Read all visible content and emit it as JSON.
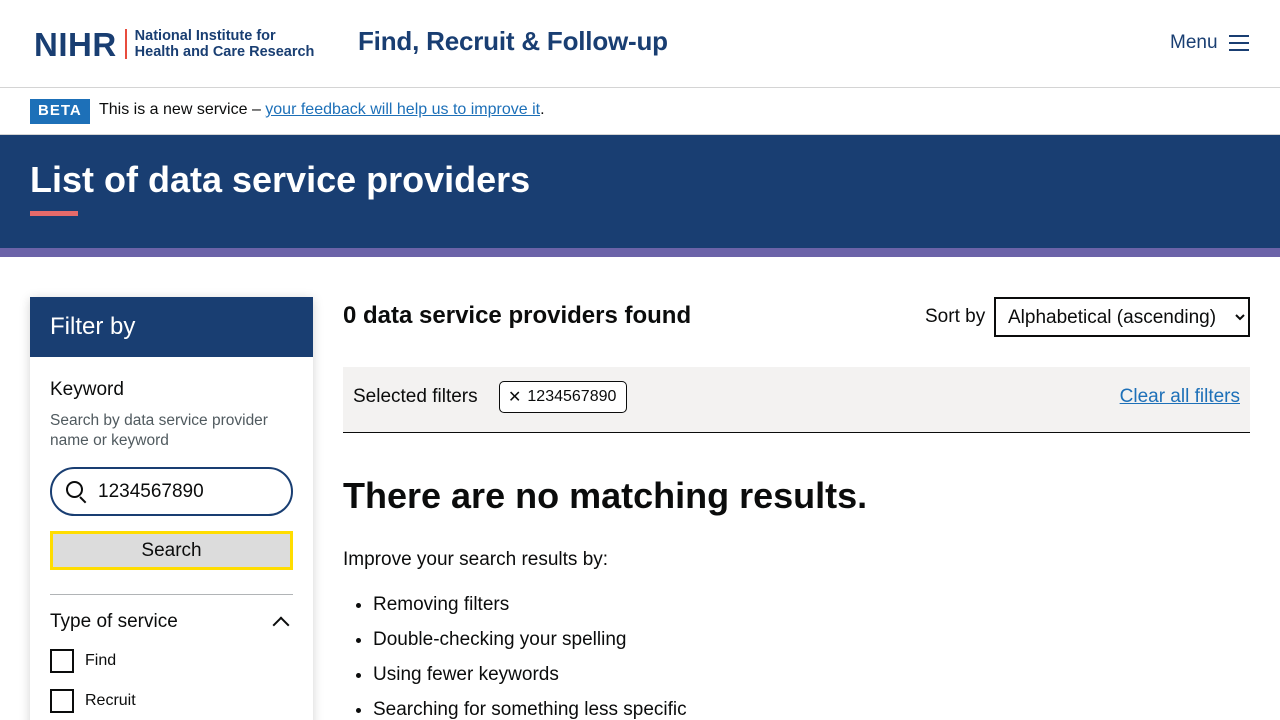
{
  "header": {
    "logo_mark": "NIHR",
    "logo_line1": "National Institute for",
    "logo_line2": "Health and Care Research",
    "service_name": "Find, Recruit & Follow-up",
    "menu_label": "Menu"
  },
  "beta_banner": {
    "tag": "BETA",
    "text_before": "This is a new service – ",
    "link_text": "your feedback will help us to improve it",
    "text_after": "."
  },
  "page": {
    "title": "List of data service providers"
  },
  "filter": {
    "heading": "Filter by",
    "keyword_label": "Keyword",
    "keyword_hint": "Search by data service provider name or keyword",
    "search_value": "1234567890",
    "search_button": "Search",
    "type_of_service_title": "Type of service",
    "options": [
      {
        "label": "Find",
        "checked": false
      },
      {
        "label": "Recruit",
        "checked": false
      }
    ]
  },
  "results": {
    "count_text": "0 data service providers found",
    "sort_label": "Sort by",
    "sort_selected": "Alphabetical (ascending)",
    "selected_filters_label": "Selected filters",
    "chip_close_glyph": "✕",
    "chip_value": "1234567890",
    "clear_all": "Clear all filters",
    "no_results_heading": "There are no matching results.",
    "improve_text": "Improve your search results by:",
    "tips": [
      "Removing filters",
      "Double-checking your spelling",
      "Using fewer keywords",
      "Searching for something less specific"
    ]
  },
  "colors": {
    "brand_navy": "#193e72",
    "accent_red": "#e84c3d",
    "band_purple": "#6b63a8",
    "link_blue": "#1d70b8",
    "focus_yellow": "#ffdd00"
  }
}
